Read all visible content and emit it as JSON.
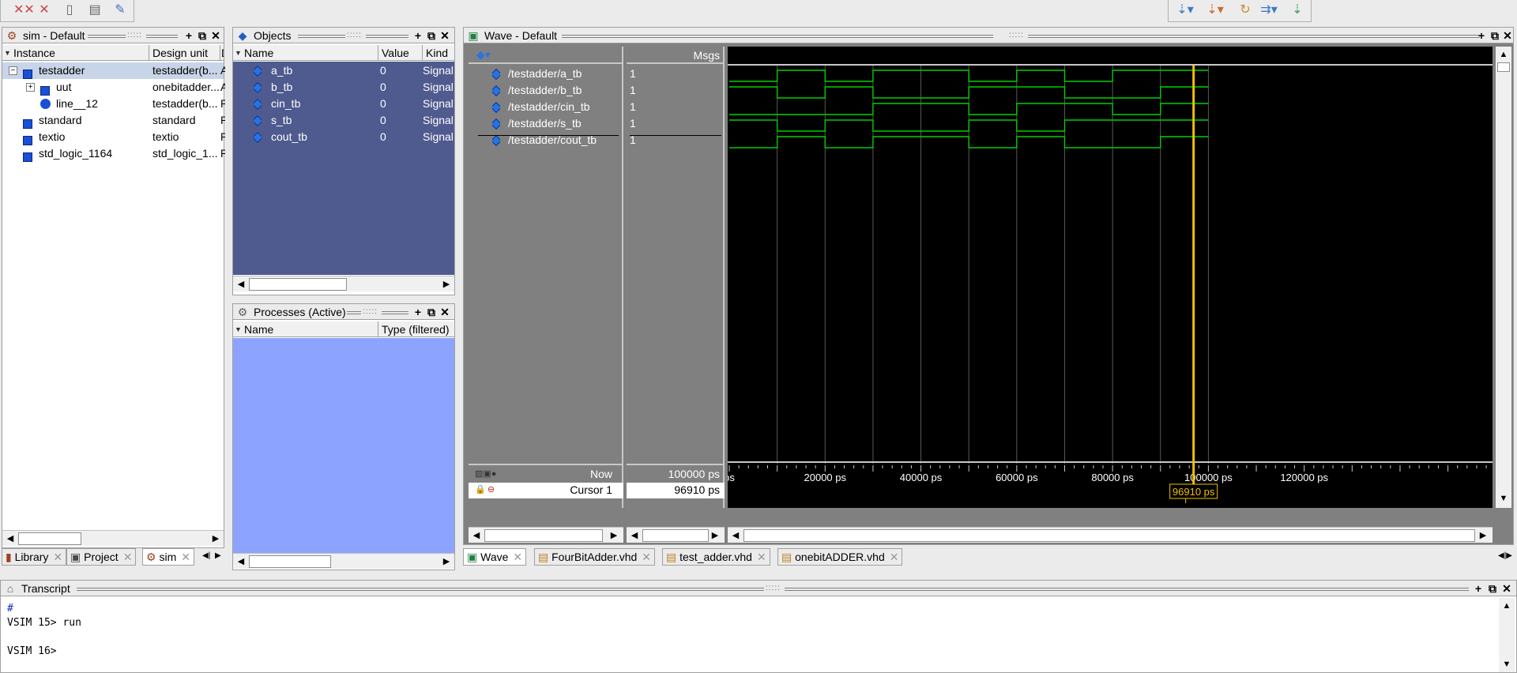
{
  "toolbar_left": {
    "icons": [
      "delete-all-breakpoints-icon",
      "remove-icon",
      "copy-icon",
      "paste-icon",
      "wave-tool-icon"
    ]
  },
  "toolbar_right": {
    "icons": [
      "step-icon",
      "step-over-icon",
      "step-out-icon",
      "continue-icon",
      "restart-icon"
    ]
  },
  "sim_pane": {
    "title": "sim - Default",
    "columns": [
      "Instance",
      "Design unit",
      "D"
    ],
    "rows": [
      {
        "instance": "testadder",
        "unit": "testadder(b...",
        "d": "A",
        "level": 0,
        "selected": true,
        "icon": "bluesq",
        "expand": "−"
      },
      {
        "instance": "uut",
        "unit": "onebitadder...",
        "d": "A",
        "level": 1,
        "icon": "bluesq",
        "expand": "+"
      },
      {
        "instance": "line__12",
        "unit": "testadder(b...",
        "d": "P",
        "level": 1,
        "icon": "ball"
      },
      {
        "instance": "standard",
        "unit": "standard",
        "d": "P",
        "level": 0,
        "icon": "bluesq"
      },
      {
        "instance": "textio",
        "unit": "textio",
        "d": "P",
        "level": 0,
        "icon": "bluesq"
      },
      {
        "instance": "std_logic_1164",
        "unit": "std_logic_1...",
        "d": "P",
        "level": 0,
        "icon": "bluesq"
      }
    ]
  },
  "left_tabs": [
    {
      "label": "Library"
    },
    {
      "label": "Project"
    },
    {
      "label": "sim"
    }
  ],
  "objects_pane": {
    "title": "Objects",
    "columns": [
      "Name",
      "Value",
      "Kind"
    ],
    "rows": [
      {
        "name": "a_tb",
        "value": "0",
        "kind": "Signal"
      },
      {
        "name": "b_tb",
        "value": "0",
        "kind": "Signal"
      },
      {
        "name": "cin_tb",
        "value": "0",
        "kind": "Signal"
      },
      {
        "name": "s_tb",
        "value": "0",
        "kind": "Signal"
      },
      {
        "name": "cout_tb",
        "value": "0",
        "kind": "Signal"
      }
    ]
  },
  "processes_pane": {
    "title": "Processes (Active)",
    "columns": [
      "Name",
      "Type (filtered)"
    ]
  },
  "wave_pane": {
    "title": "Wave - Default",
    "msgs_label": "Msgs",
    "signals": [
      {
        "name": "/testadder/a_tb",
        "value": "1"
      },
      {
        "name": "/testadder/b_tb",
        "value": "1"
      },
      {
        "name": "/testadder/cin_tb",
        "value": "1"
      },
      {
        "name": "/testadder/s_tb",
        "value": "1"
      },
      {
        "name": "/testadder/cout_tb",
        "value": "1"
      }
    ],
    "now_label": "Now",
    "now_value": "100000 ps",
    "cursor_label": "Cursor 1",
    "cursor_value": "96910 ps",
    "cursor_flag": "96910 ps",
    "time_ticks": [
      {
        "t": 0,
        "label": "ps"
      },
      {
        "t": 20000,
        "label": "20000 ps"
      },
      {
        "t": 40000,
        "label": "40000 ps"
      },
      {
        "t": 60000,
        "label": "60000 ps"
      },
      {
        "t": 80000,
        "label": "80000 ps"
      },
      {
        "t": 100000,
        "label": "100000 ps"
      },
      {
        "t": 120000,
        "label": "120000 ps"
      }
    ],
    "cursor_time": 96910,
    "sim_end": 100000,
    "waves": [
      [
        0,
        1,
        0,
        1,
        1,
        0,
        1,
        0,
        1,
        1
      ],
      [
        1,
        0,
        1,
        0,
        0,
        1,
        1,
        0,
        0,
        1
      ],
      [
        0,
        0,
        0,
        1,
        1,
        0,
        1,
        1,
        0,
        1
      ],
      [
        1,
        0,
        1,
        0,
        0,
        1,
        0,
        1,
        1,
        1
      ],
      [
        0,
        1,
        0,
        1,
        1,
        0,
        1,
        0,
        0,
        1
      ]
    ],
    "colors": {
      "wave": "#00d000",
      "cursor": "#f0c000",
      "grid": "#5a5a5a"
    }
  },
  "bottom_tabs": [
    {
      "label": "Wave"
    },
    {
      "label": "FourBitAdder.vhd"
    },
    {
      "label": "test_adder.vhd"
    },
    {
      "label": "onebitADDER.vhd"
    }
  ],
  "transcript": {
    "title": "Transcript",
    "lines": [
      {
        "text": "#",
        "kind": "comment"
      },
      {
        "text": "VSIM 15> run",
        "kind": "cmd"
      },
      {
        "text": "",
        "kind": "blank"
      },
      {
        "text": "VSIM 16>",
        "kind": "cmd"
      }
    ]
  }
}
